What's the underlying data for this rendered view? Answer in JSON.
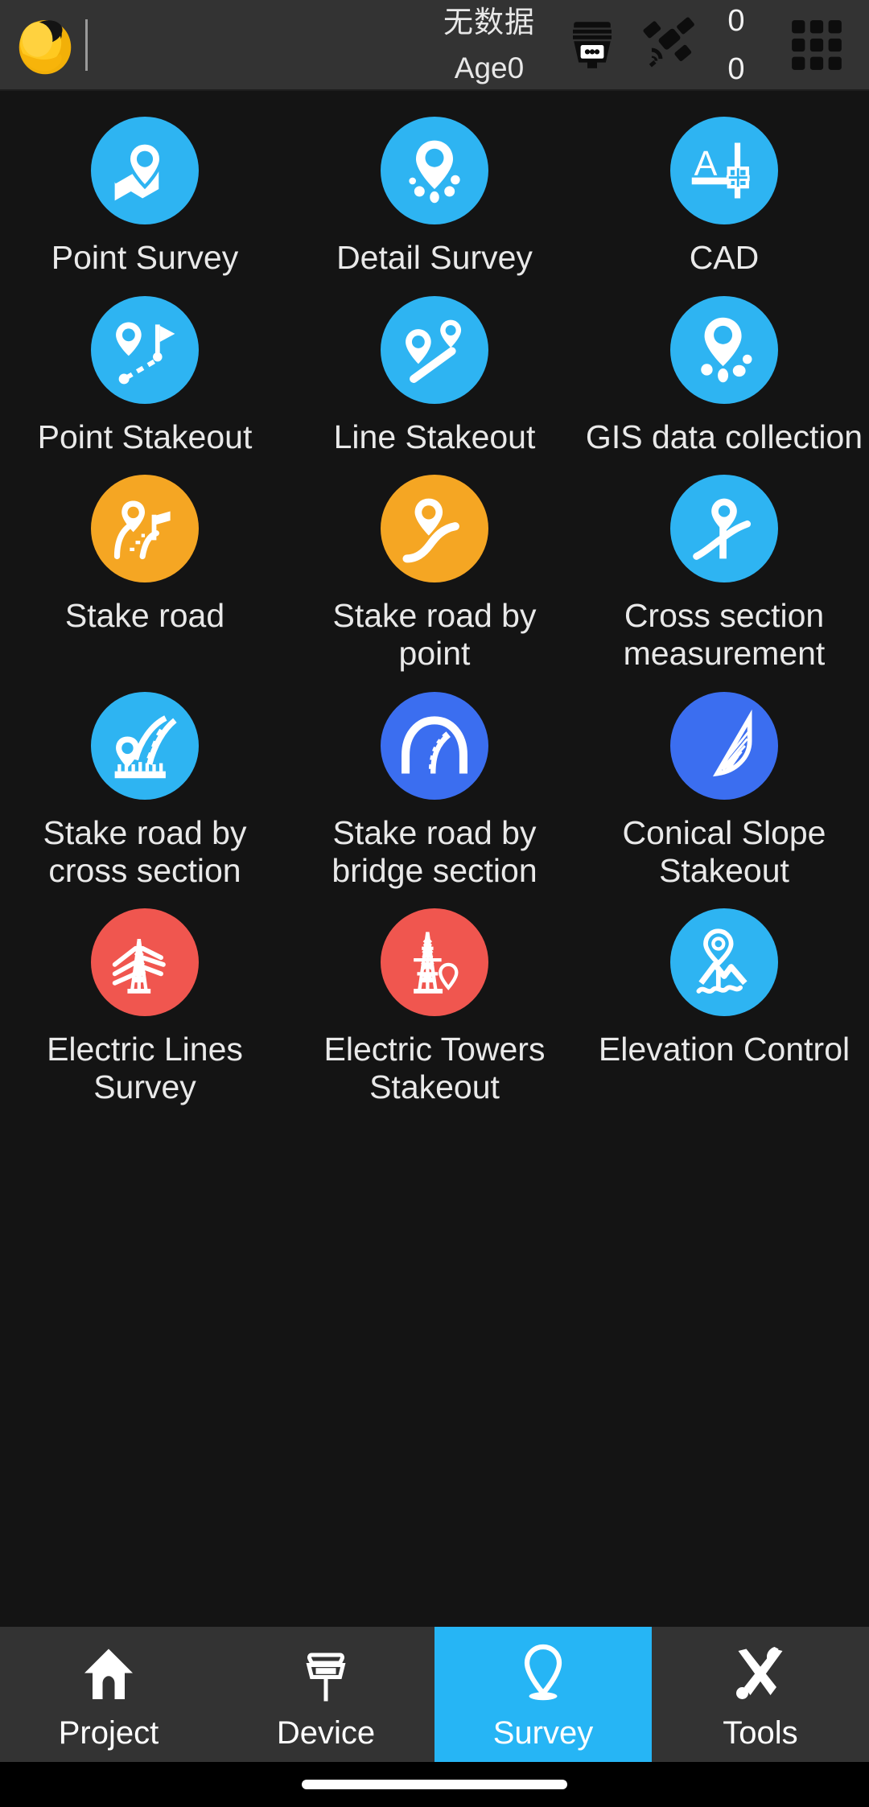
{
  "app": {
    "accent_blue": "#26b5f5",
    "accent_orange": "#f5a623",
    "accent_royal": "#3b6ef0",
    "accent_red": "#f0564f",
    "background": "#141414",
    "bar_background": "#333333"
  },
  "header": {
    "logo_icon": "hard-hat-icon",
    "data_status": "无数据",
    "age_label": "Age0",
    "receiver_icon": "gnss-receiver-icon",
    "satellite_icon": "satellite-icon",
    "satellites_used": "0",
    "satellites_total": "0",
    "grid_menu_icon": "grid-menu-icon"
  },
  "grid": {
    "items": [
      {
        "label": "Point Survey",
        "icon": "pin-map-icon",
        "color": "#2eb4f2"
      },
      {
        "label": "Detail Survey",
        "icon": "pin-dots-icon",
        "color": "#2eb4f2"
      },
      {
        "label": "CAD",
        "icon": "cad-ruler-icon",
        "color": "#2eb4f2"
      },
      {
        "label": "Point Stakeout",
        "icon": "pin-flag-path-icon",
        "color": "#2eb4f2"
      },
      {
        "label": "Line Stakeout",
        "icon": "pin-line-icon",
        "color": "#2eb4f2"
      },
      {
        "label": "GIS data collection",
        "icon": "pin-cluster-icon",
        "color": "#2eb4f2"
      },
      {
        "label": "Stake road",
        "icon": "road-stake-icon",
        "color": "#f5a623"
      },
      {
        "label": "Stake road by point",
        "icon": "road-point-icon",
        "color": "#f5a623"
      },
      {
        "label": "Cross section measurement",
        "icon": "cross-section-icon",
        "color": "#2eb4f2"
      },
      {
        "label": "Stake road by cross section",
        "icon": "road-cross-section-icon",
        "color": "#2eb4f2"
      },
      {
        "label": "Stake road by bridge section",
        "icon": "bridge-arc-icon",
        "color": "#3b6ef0"
      },
      {
        "label": "Conical Slope Stakeout",
        "icon": "conical-slope-icon",
        "color": "#3b6ef0"
      },
      {
        "label": "Electric Lines Survey",
        "icon": "power-lines-icon",
        "color": "#f0564f"
      },
      {
        "label": "Electric Towers Stakeout",
        "icon": "power-tower-pin-icon",
        "color": "#f0564f"
      },
      {
        "label": "Elevation Control",
        "icon": "elevation-pin-icon",
        "color": "#2eb4f2"
      }
    ]
  },
  "tabbar": {
    "tabs": [
      {
        "label": "Project",
        "icon": "house-icon",
        "active": false
      },
      {
        "label": "Device",
        "icon": "gnss-pole-icon",
        "active": false
      },
      {
        "label": "Survey",
        "icon": "map-pin-icon",
        "active": true
      },
      {
        "label": "Tools",
        "icon": "tools-icon",
        "active": false
      }
    ]
  }
}
